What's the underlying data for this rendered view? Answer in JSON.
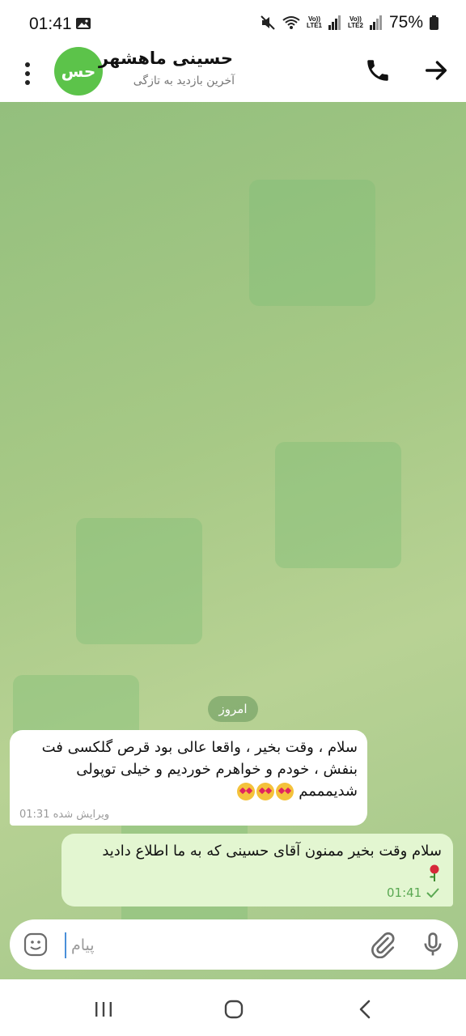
{
  "status_bar": {
    "time": "01:41",
    "battery": "75%",
    "sim1": "LTE1",
    "sim2": "LTE2",
    "volte": "Vo))"
  },
  "header": {
    "avatar_initials": "حس",
    "avatar_color": "#5cc34a",
    "contact_name": "حسینی ماهشهر",
    "status": "آخرین بازدید به تازگی"
  },
  "chat": {
    "date_label": "امروز",
    "messages": [
      {
        "direction": "incoming",
        "line1": "سلام ، وقت بخیر ، واقعا عالی بود قرص گلکسی فت",
        "line2": "بنفش ، خودم و خواهرم خوردیم و خیلی توپولی",
        "line3": "شدیمممم",
        "meta": "ویرایش شده 01:31"
      },
      {
        "direction": "outgoing",
        "line1": "سلام وقت بخیر ممنون آقای حسینی که به ما اطلاع دادید",
        "time": "01:41",
        "status": "sent-check"
      }
    ]
  },
  "input": {
    "placeholder": "پیام"
  },
  "colors": {
    "outgoing_bubble": "#e3f6d1",
    "check_green": "#5aa852",
    "accent_blue": "#4a90d9"
  }
}
